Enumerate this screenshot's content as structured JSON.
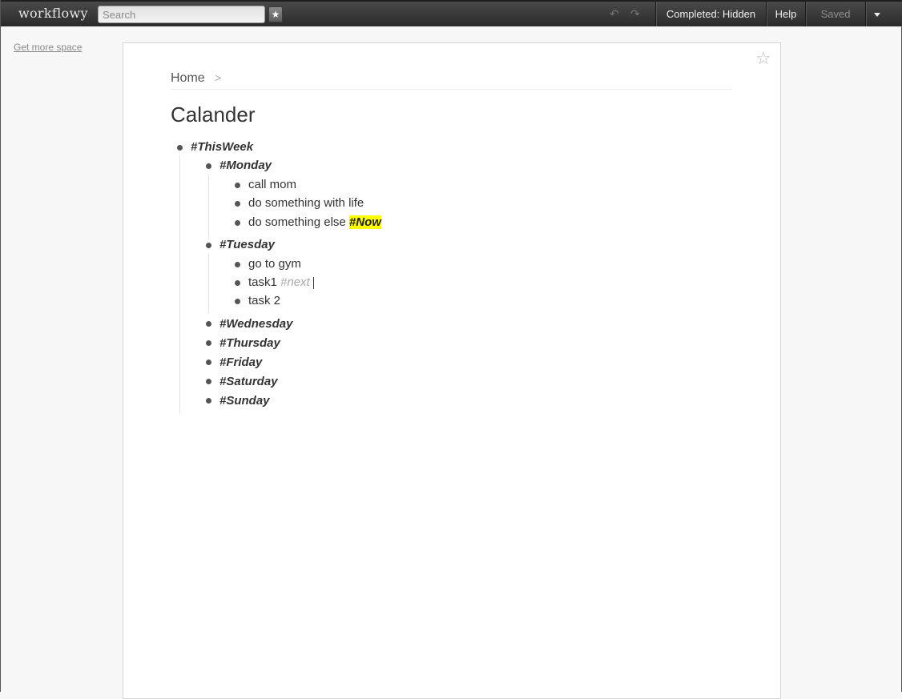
{
  "topbar": {
    "logo": "workflowy",
    "search_placeholder": "Search",
    "star_icon": "★",
    "undo_icon": "↶",
    "redo_icon": "↷",
    "completed_label": "Completed: Hidden",
    "help_label": "Help",
    "saved_label": "Saved"
  },
  "sidebar": {
    "get_more_space": "Get more space"
  },
  "page": {
    "fav_star_icon": "☆",
    "breadcrumb": {
      "home": "Home",
      "separator": ">"
    },
    "title": "Calander",
    "outline": {
      "root": "#ThisWeek",
      "monday": {
        "label": "#Monday",
        "items": [
          "call mom",
          "do something with life",
          "do something else"
        ],
        "item3_tag": "#Now"
      },
      "tuesday": {
        "label": "#Tuesday",
        "items": [
          "go to gym",
          "task1",
          "task 2"
        ],
        "item2_tag": "#next"
      },
      "days": [
        "#Wednesday",
        "#Thursday",
        "#Friday",
        "#Saturday",
        "#Sunday"
      ]
    }
  },
  "colors": {
    "highlight": "#ffff00",
    "topbar": "#333333"
  }
}
